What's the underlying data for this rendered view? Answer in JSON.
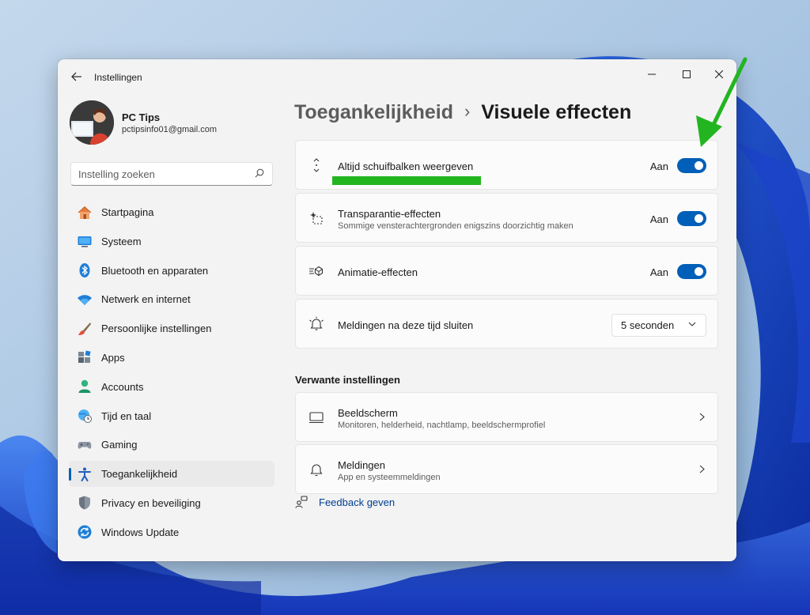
{
  "window": {
    "app_title": "Instellingen"
  },
  "profile": {
    "name": "PC Tips",
    "email": "pctipsinfo01@gmail.com"
  },
  "search": {
    "placeholder": "Instelling zoeken"
  },
  "sidebar": {
    "items": [
      {
        "label": "Startpagina",
        "icon": "home-icon"
      },
      {
        "label": "Systeem",
        "icon": "system-icon"
      },
      {
        "label": "Bluetooth en apparaten",
        "icon": "bluetooth-icon"
      },
      {
        "label": "Netwerk en internet",
        "icon": "wifi-icon"
      },
      {
        "label": "Persoonlijke instellingen",
        "icon": "brush-icon"
      },
      {
        "label": "Apps",
        "icon": "apps-icon"
      },
      {
        "label": "Accounts",
        "icon": "accounts-icon"
      },
      {
        "label": "Tijd en taal",
        "icon": "globe-clock-icon"
      },
      {
        "label": "Gaming",
        "icon": "gamepad-icon"
      },
      {
        "label": "Toegankelijkheid",
        "icon": "accessibility-icon",
        "active": true
      },
      {
        "label": "Privacy en beveiliging",
        "icon": "shield-icon"
      },
      {
        "label": "Windows Update",
        "icon": "update-icon"
      }
    ]
  },
  "breadcrumb": {
    "parent": "Toegankelijkheid",
    "separator": "›",
    "current": "Visuele effecten"
  },
  "settings": {
    "scrollbars": {
      "title": "Altijd schuifbalken weergeven",
      "state_label": "Aan",
      "on": true
    },
    "transparency": {
      "title": "Transparantie-effecten",
      "subtitle": "Sommige vensterachtergronden enigszins doorzichtig maken",
      "state_label": "Aan",
      "on": true
    },
    "animation": {
      "title": "Animatie-effecten",
      "state_label": "Aan",
      "on": true
    },
    "notifications_timeout": {
      "title": "Meldingen na deze tijd sluiten",
      "value": "5 seconden"
    }
  },
  "related": {
    "title": "Verwante instellingen",
    "items": [
      {
        "title": "Beeldscherm",
        "subtitle": "Monitoren, helderheid, nachtlamp, beeldschermprofiel"
      },
      {
        "title": "Meldingen",
        "subtitle": "App en systeemmeldingen"
      }
    ]
  },
  "feedback": {
    "label": "Feedback geven"
  },
  "colors": {
    "accent": "#005fb8",
    "annotation": "#23b520"
  }
}
